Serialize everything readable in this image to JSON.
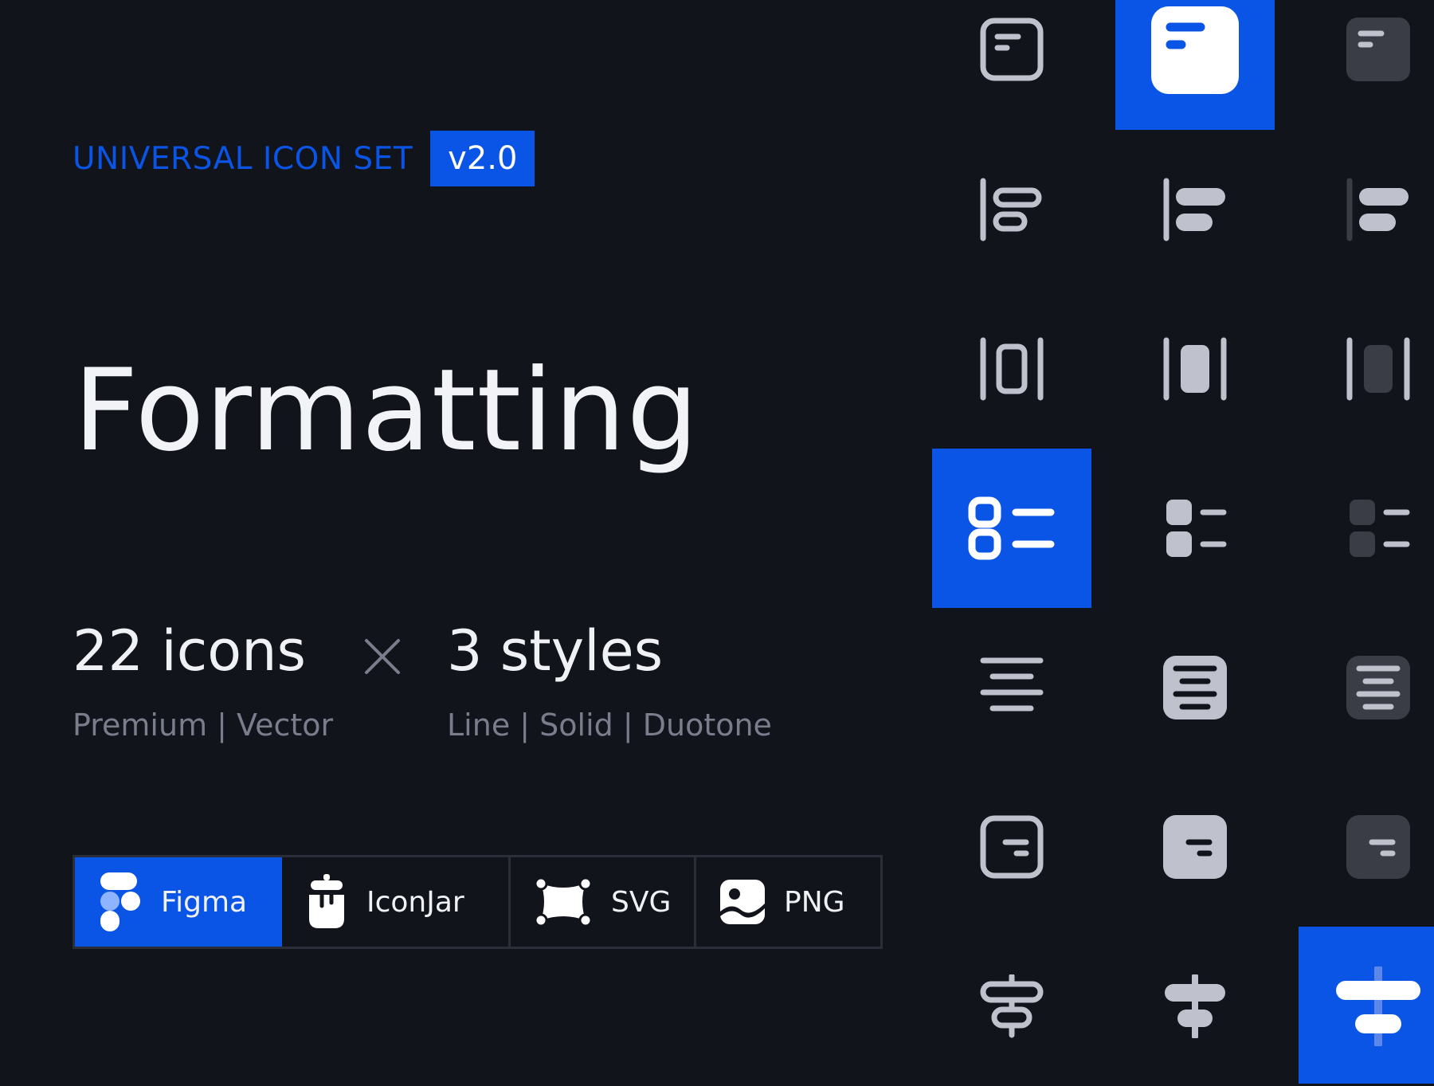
{
  "brand": {
    "title": "UNIVERSAL ICON SET",
    "version": "v2.0"
  },
  "hero": {
    "title": "Formatting"
  },
  "stats": {
    "icons_count": "22 icons",
    "icons_sub": "Premium | Vector",
    "styles_count": "3 styles",
    "styles_sub": "Line | Solid | Duotone"
  },
  "formats": [
    {
      "label": "Figma",
      "icon": "figma-icon",
      "active": true
    },
    {
      "label": "IconJar",
      "icon": "iconjar-icon",
      "active": false
    },
    {
      "label": "SVG",
      "icon": "svg-icon",
      "active": false
    },
    {
      "label": "PNG",
      "icon": "png-icon",
      "active": false
    }
  ],
  "colors": {
    "background": "#12141c",
    "accent": "#0a54e6",
    "icon": "#bfc1cc",
    "duotone_dark": "#3a3c46"
  },
  "icon_grid": [
    [
      "align-top-left-line-icon",
      "align-top-left-solid-icon",
      "align-top-left-duotone-icon"
    ],
    [
      "align-left-line-icon",
      "align-left-solid-icon",
      "align-left-duotone-icon"
    ],
    [
      "align-horizontal-center-line-icon",
      "align-horizontal-center-solid-icon",
      "align-horizontal-center-duotone-icon"
    ],
    [
      "list-checkbox-line-icon",
      "list-checkbox-solid-icon",
      "list-checkbox-duotone-icon"
    ],
    [
      "text-align-center-line-icon",
      "text-align-center-solid-icon",
      "text-align-center-duotone-icon"
    ],
    [
      "align-right-box-line-icon",
      "align-right-box-solid-icon",
      "align-right-box-duotone-icon"
    ],
    [
      "align-vertical-center-line-icon",
      "align-vertical-center-solid-icon",
      "align-vertical-center-duotone-icon"
    ]
  ]
}
